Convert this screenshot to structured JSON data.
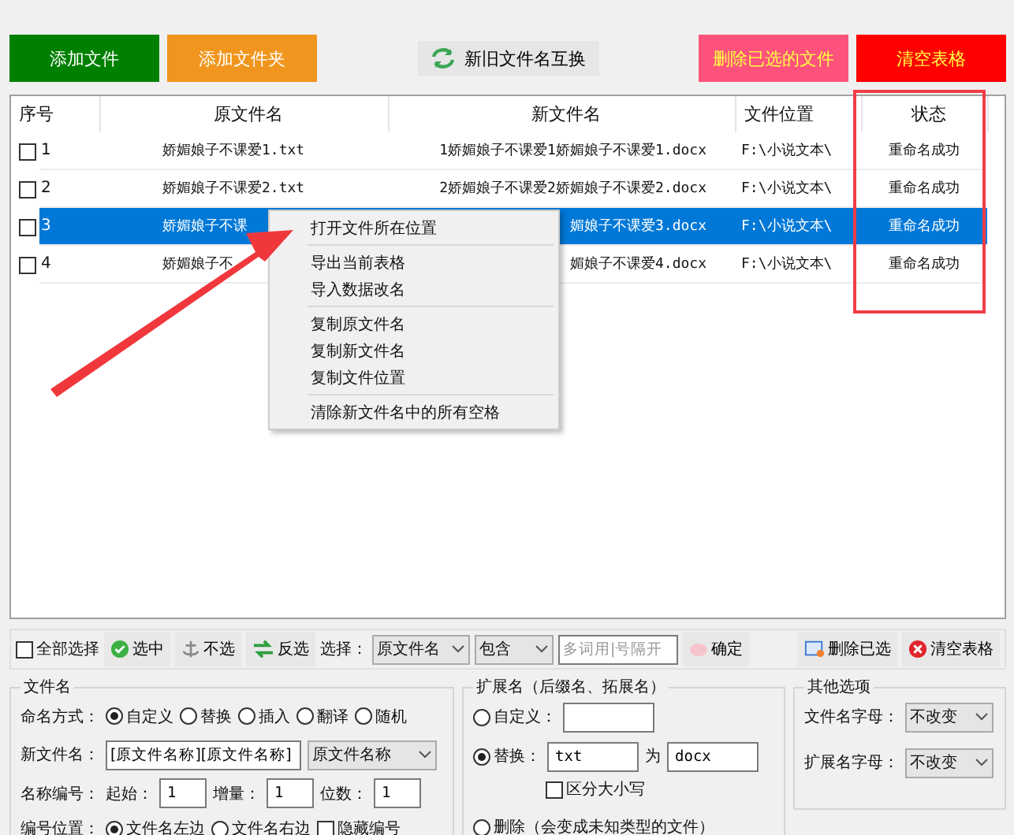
{
  "top_buttons": [
    {
      "label": "添加文件",
      "kind": "green"
    },
    {
      "label": "添加文件夹",
      "kind": "orange"
    },
    {
      "label": "新旧文件名互换",
      "kind": "swap"
    },
    {
      "label": "删除已选的文件",
      "kind": "pink"
    },
    {
      "label": "清空表格",
      "kind": "red"
    }
  ],
  "table": {
    "columns": [
      "序号",
      "原文件名",
      "新文件名",
      "文件位置",
      "状态"
    ],
    "rows": [
      {
        "checked": false,
        "selected": false,
        "cells": [
          "1",
          "娇媚娘子不课爱1.txt",
          "1娇媚娘子不课爱1娇媚娘子不课爱1.docx",
          "F:\\小说文本\\",
          "重命名成功"
        ]
      },
      {
        "checked": false,
        "selected": false,
        "cells": [
          "2",
          "娇媚娘子不课爱2.txt",
          "2娇媚娘子不课爱2娇媚娘子不课爱2.docx",
          "F:\\小说文本\\",
          "重命名成功"
        ]
      },
      {
        "checked": false,
        "selected": true,
        "cells": [
          "3",
          "娇媚娘子不课",
          "媚娘子不课爱3.docx",
          "F:\\小说文本\\",
          "重命名成功"
        ]
      },
      {
        "checked": false,
        "selected": false,
        "cells": [
          "4",
          "娇媚娘子不",
          "媚娘子不课爱4.docx",
          "F:\\小说文本\\",
          "重命名成功"
        ]
      }
    ]
  },
  "context_menu": [
    [
      "打开文件所在位置"
    ],
    [
      "导出当前表格",
      "导入数据改名"
    ],
    [
      "复制原文件名",
      "复制新文件名",
      "复制文件位置"
    ],
    [
      "清除新文件名中的所有空格"
    ]
  ],
  "toolbar": {
    "select_all": {
      "label": "全部选择",
      "checked": false
    },
    "buttons": [
      {
        "label": "选中",
        "kind": "check"
      },
      {
        "label": "不选",
        "kind": "anchor"
      },
      {
        "label": "反选",
        "kind": "swap"
      }
    ],
    "filter_label": "选择：",
    "field_select": "原文件名",
    "match_select": "包含",
    "keyword_placeholder": "多词用|号隔开",
    "confirm": "确定",
    "delete_selected": "删除已选",
    "clear_table": "清空表格"
  },
  "file_name_panel": {
    "title": "文件名",
    "mode_label": "命名方式：",
    "modes": [
      {
        "label": "自定义",
        "selected": true
      },
      {
        "label": "替换",
        "selected": false
      },
      {
        "label": "插入",
        "selected": false
      },
      {
        "label": "翻译",
        "selected": false
      },
      {
        "label": "随机",
        "selected": false
      }
    ],
    "new_name_label": "新文件名：",
    "new_name_value": "[原文件名称][原文件名称]",
    "new_name_select": "原文件名称",
    "numbering_label": "名称编号：",
    "start_label": "起始：",
    "start_value": "1",
    "step_label": "增量：",
    "step_value": "1",
    "digits_label": "位数：",
    "digits_value": "1",
    "position_label": "编号位置：",
    "positions": [
      {
        "label": "文件名左边",
        "selected": true
      },
      {
        "label": "文件名右边",
        "selected": false
      }
    ],
    "hide_number": {
      "label": "隐藏编号",
      "checked": false
    }
  },
  "extension_panel": {
    "title": "扩展名（后缀名、拓展名）",
    "custom": {
      "label": "自定义：",
      "selected": false
    },
    "replace": {
      "label": "替换：",
      "selected": true,
      "from": "txt",
      "to_label": "为",
      "to": "docx"
    },
    "case_sensitive": {
      "label": "区分大小写",
      "checked": false
    },
    "delete": {
      "label": "删除（会变成未知类型的文件）",
      "selected": false
    }
  },
  "other_panel": {
    "title": "其他选项",
    "rows": [
      {
        "label": "文件名字母：",
        "value": "不改变"
      },
      {
        "label": "扩展名字母：",
        "value": "不改变"
      }
    ]
  }
}
